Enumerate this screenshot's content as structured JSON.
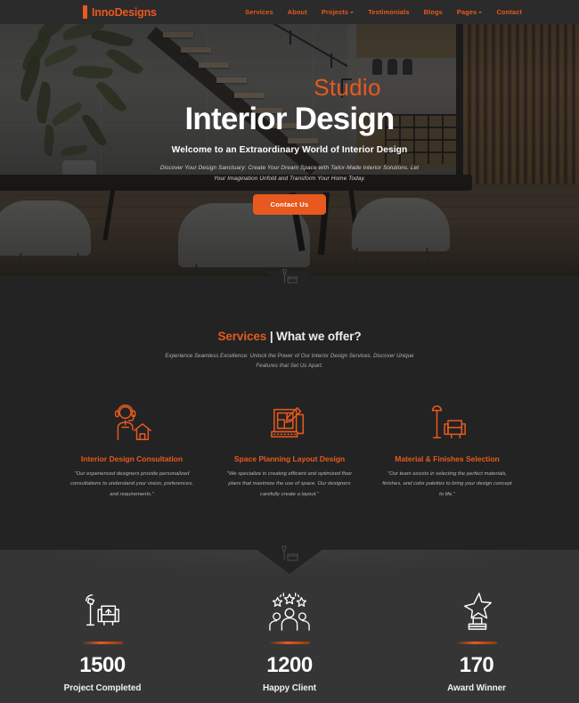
{
  "header": {
    "logo": {
      "text": "InnoDesigns",
      "icon": "logo-bar-icon",
      "color": "#E8591F"
    },
    "nav": [
      {
        "label": "Services",
        "dropdown": false
      },
      {
        "label": "About",
        "dropdown": false
      },
      {
        "label": "Projects",
        "dropdown": true
      },
      {
        "label": "Testimonials",
        "dropdown": false
      },
      {
        "label": "Blogs",
        "dropdown": false
      },
      {
        "label": "Pages",
        "dropdown": true
      },
      {
        "label": "Contact",
        "dropdown": false
      }
    ]
  },
  "hero": {
    "eyebrow": "Studio",
    "title": "Interior Design",
    "subtitle": "Welcome to an Extraordinary World of Interior Design",
    "description": "Discover Your Design Sanctuary: Create Your Dream Space with Tailor-Made Interior Solutions. Let Your Imagination Unfold and Transform Your Home Today.",
    "cta_label": "Contact Us",
    "cta_color": "#E8591F"
  },
  "services": {
    "title_accent": "Services",
    "title_plain": "| What we offer?",
    "subtitle": "Experience Seamless Excellence: Unlock the Power of Our Interior Design Services. Discover Unique Features that Set Us Apart.",
    "cards": [
      {
        "icon": "consultant-house-icon",
        "title": "Interior Design Consultation",
        "desc": "\"Our experienced designers provide personalized consultations to understand your vision, preferences, and requirements.\""
      },
      {
        "icon": "blueprint-floorplan-icon",
        "title": "Space Planning Layout Design",
        "desc": "\"We specialize in creating efficient and optimized floor plans that maximize the use of space. Our designers carefully create a layout.\""
      },
      {
        "icon": "lamp-sofa-icon",
        "title": "Material & Finishes Selection",
        "desc": "\"Our team assists in selecting the perfect materials, finishes, and color palettes to bring your design concept to life.\""
      }
    ]
  },
  "stats": {
    "items": [
      {
        "icon": "lamp-armchair-icon",
        "number": "1500",
        "label": "Project Completed"
      },
      {
        "icon": "people-stars-icon",
        "number": "1200",
        "label": "Happy Client"
      },
      {
        "icon": "star-trophy-icon",
        "number": "170",
        "label": "Award Winner"
      }
    ]
  },
  "theme": {
    "accent": "#E8591F",
    "services_bg": "#232323",
    "stats_bg": "#353535",
    "header_bg": "#2B2B2B"
  }
}
